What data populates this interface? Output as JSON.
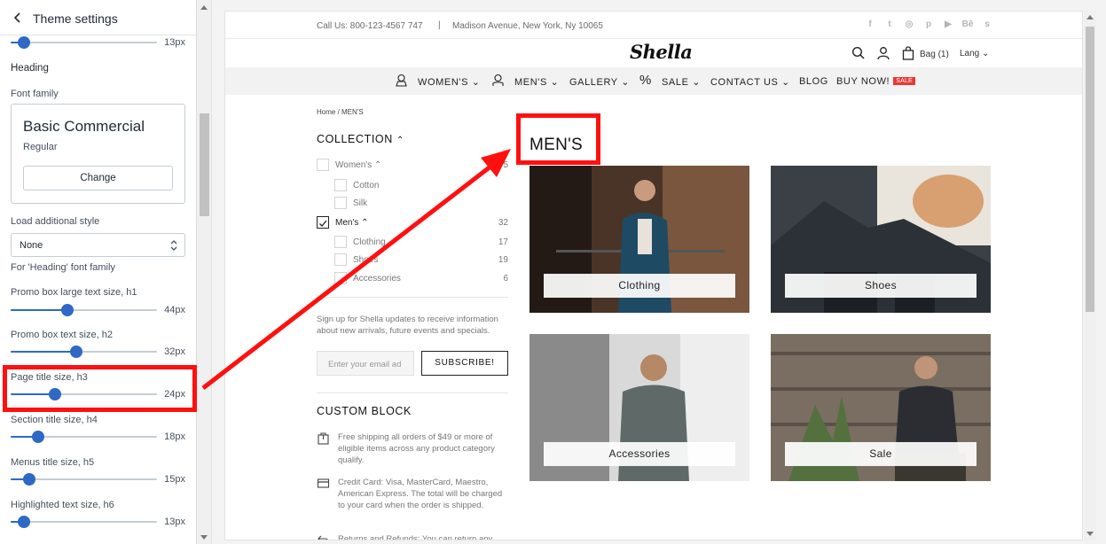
{
  "panel": {
    "title": "Theme settings",
    "top_slider": {
      "value_label": "13px",
      "fraction": 0.09
    },
    "heading_section": "Heading",
    "font_family_label": "Font family",
    "font_name": "Basic Commercial",
    "font_style": "Regular",
    "change_button": "Change",
    "load_style_label": "Load additional style",
    "load_style_value": "None",
    "load_style_hint": "For 'Heading' font family",
    "sliders": [
      {
        "label": "Promo box large text size, h1",
        "value_label": "44px",
        "fraction": 0.39
      },
      {
        "label": "Promo box text size, h2",
        "value_label": "32px",
        "fraction": 0.45
      },
      {
        "label": "Page title size, h3",
        "value_label": "24px",
        "fraction": 0.3
      },
      {
        "label": "Section title size, h4",
        "value_label": "18px",
        "fraction": 0.19
      },
      {
        "label": "Menus title size, h5",
        "value_label": "15px",
        "fraction": 0.13
      },
      {
        "label": "Highlighted text size, h6",
        "value_label": "13px",
        "fraction": 0.09
      }
    ],
    "accent_color": "#2f69c5"
  },
  "store": {
    "call": "Call Us: 800-123-4567 747",
    "separator": "|",
    "address": "Madison Avenue, New York, Ny 10065",
    "socials": [
      "f",
      "t",
      "◎",
      "p",
      "▶",
      "Bē",
      "s"
    ],
    "logo": "Shella",
    "bag_label": "Bag (1)",
    "lang_label": "Lang",
    "nav": {
      "womens": "WOMEN'S",
      "mens": "MEN'S",
      "gallery": "GALLERY",
      "sale": "SALE",
      "contact": "CONTACT US",
      "blog": "BLOG",
      "buy": "BUY NOW!",
      "sale_badge": "SALE"
    },
    "breadcrumb": "Home  /  MEN'S",
    "collection_title": "COLLECTION",
    "filters": {
      "womens": {
        "label": "Women's",
        "count": "5"
      },
      "cotton": {
        "label": "Cotton"
      },
      "silk": {
        "label": "Silk"
      },
      "mens": {
        "label": "Men's",
        "count": "32"
      },
      "clothing": {
        "label": "Clothing",
        "count": "17"
      },
      "shoes": {
        "label": "Shoes",
        "count": "19"
      },
      "accessories": {
        "label": "Accessories",
        "count": "6"
      }
    },
    "signup_text": "Sign up for Shella updates to receive information about new arrivals, future events and specials.",
    "email_placeholder": "Enter your email ad",
    "subscribe": "SUBSCRIBE!",
    "custom_block_title": "CUSTOM BLOCK",
    "custom_items": [
      "Free shipping all orders of $49 or more of eligible items across any product category qualify.",
      "Credit Card: Visa, MasterCard, Maestro, American Express. The total will be charged to your card when the order is shipped.",
      "Returns and Refunds: You can return any"
    ],
    "page_title": "MEN'S",
    "cards": [
      "Clothing",
      "Shoes",
      "Accessories",
      "Sale"
    ]
  }
}
